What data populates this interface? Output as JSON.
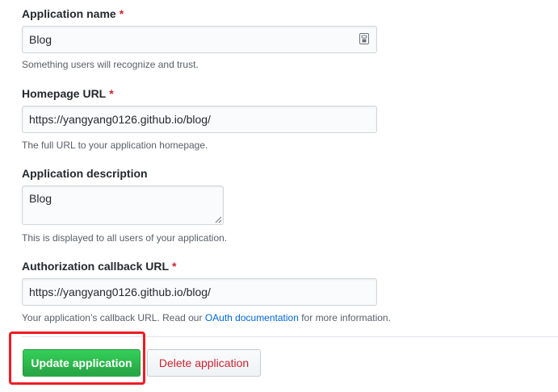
{
  "form": {
    "app_name": {
      "label": "Application name",
      "required_mark": "*",
      "value": "Blog",
      "note": "Something users will recognize and trust.",
      "icon": "password-manager-icon"
    },
    "homepage": {
      "label": "Homepage URL",
      "required_mark": "*",
      "value": "https://yangyang0126.github.io/blog/",
      "note": "The full URL to your application homepage."
    },
    "description": {
      "label": "Application description",
      "value": "Blog",
      "note": "This is displayed to all users of your application."
    },
    "callback": {
      "label": "Authorization callback URL",
      "required_mark": "*",
      "value": "https://yangyang0126.github.io/blog/",
      "note_prefix": "Your application’s callback URL. Read our ",
      "note_link": "OAuth documentation",
      "note_suffix": " for more information."
    },
    "buttons": {
      "update_label": "Update application",
      "delete_label": "Delete application"
    }
  },
  "colors": {
    "primary": "#28a745",
    "danger": "#cb2431",
    "link": "#0366d6",
    "highlight": "#ee1c25"
  }
}
